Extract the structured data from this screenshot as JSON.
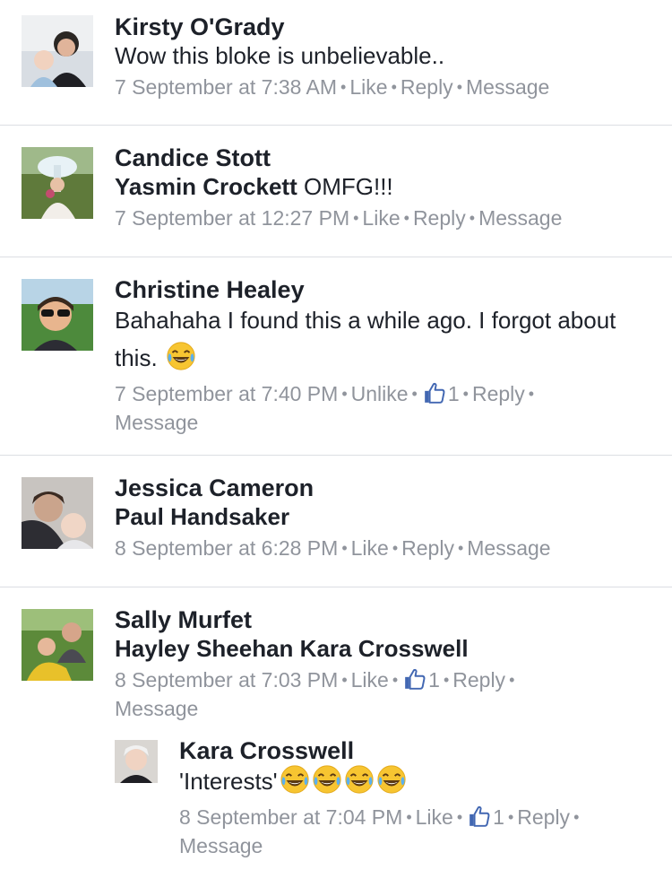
{
  "comments": [
    {
      "author": "Kirsty O'Grady",
      "text": "Wow this bloke is unbelievable..",
      "time": "7 September at 7:38 AM",
      "like": "Like",
      "reply": "Reply",
      "message": "Message"
    },
    {
      "author": "Candice Stott",
      "tag": "Yasmin Crockett",
      "text": "OMFG!!!",
      "time": "7 September at 12:27 PM",
      "like": "Like",
      "reply": "Reply",
      "message": "Message"
    },
    {
      "author": "Christine Healey",
      "text": "Bahahaha I found this a while ago. I forgot about this.",
      "emoji": "laughing-crying-emoji",
      "time": "7 September at 7:40 PM",
      "like": "Unlike",
      "likes": "1",
      "reply": "Reply",
      "message": "Message"
    },
    {
      "author": "Jessica Cameron",
      "tag": "Paul Handsaker",
      "time": "8 September at 6:28 PM",
      "like": "Like",
      "reply": "Reply",
      "message": "Message"
    },
    {
      "author": "Sally Murfet",
      "tag": "Hayley Sheehan",
      "tag2": "Kara Crosswell",
      "time": "8 September at 7:03 PM",
      "like": "Like",
      "likes": "1",
      "reply": "Reply",
      "message": "Message"
    }
  ],
  "reply": {
    "author": "Kara Crosswell",
    "text": "'Interests'",
    "emoji_count": 4,
    "time": "8 September at 7:04 PM",
    "like": "Like",
    "likes": "1",
    "reply": "Reply",
    "message": "Message"
  },
  "colors": {
    "meta": "#90949c",
    "divider": "#dcdee3",
    "like_blue": "#4267b2"
  }
}
